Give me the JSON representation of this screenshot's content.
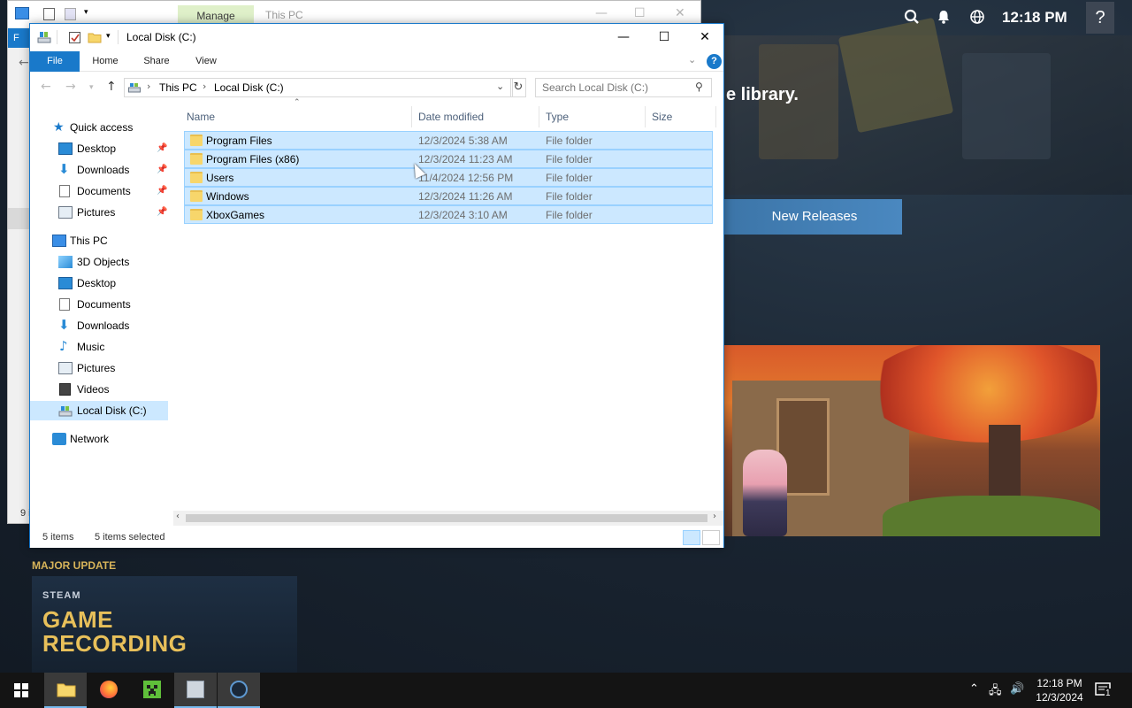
{
  "steam": {
    "clock": "12:18 PM",
    "help": "?",
    "library_fragment": "e library.",
    "new_releases": "New Releases",
    "major_update": "MAJOR UPDATE",
    "banner_brand": "STEAM",
    "banner_line1": "GAME",
    "banner_line2": "RECORDING"
  },
  "back_window": {
    "manage_tab": "Manage",
    "title": "This PC",
    "file_tab": "F",
    "status_fragment": "9 i"
  },
  "window": {
    "title": "Local Disk (C:)",
    "accent": "#1979ca",
    "ribbon_tabs": [
      "File",
      "Home",
      "Share",
      "View"
    ],
    "help": "?",
    "breadcrumb": [
      "This PC",
      "Local Disk (C:)"
    ],
    "search_placeholder": "Search Local Disk (C:)"
  },
  "nav_pane": {
    "quick_access": "Quick access",
    "quick_items": [
      "Desktop",
      "Downloads",
      "Documents",
      "Pictures"
    ],
    "this_pc": "This PC",
    "pc_items": [
      "3D Objects",
      "Desktop",
      "Documents",
      "Downloads",
      "Music",
      "Pictures",
      "Videos",
      "Local Disk (C:)"
    ],
    "network": "Network"
  },
  "columns": [
    "Name",
    "Date modified",
    "Type",
    "Size"
  ],
  "files": [
    {
      "name": "Program Files",
      "date": "12/3/2024 5:38 AM",
      "type": "File folder"
    },
    {
      "name": "Program Files (x86)",
      "date": "12/3/2024 11:23 AM",
      "type": "File folder"
    },
    {
      "name": "Users",
      "date": "11/4/2024 12:56 PM",
      "type": "File folder"
    },
    {
      "name": "Windows",
      "date": "12/3/2024 11:26 AM",
      "type": "File folder"
    },
    {
      "name": "XboxGames",
      "date": "12/3/2024 3:10 AM",
      "type": "File folder"
    }
  ],
  "status": {
    "count": "5 items",
    "selected": "5 items selected"
  },
  "taskbar": {
    "time": "12:18 PM",
    "date": "12/3/2024",
    "notif_count": "1"
  }
}
